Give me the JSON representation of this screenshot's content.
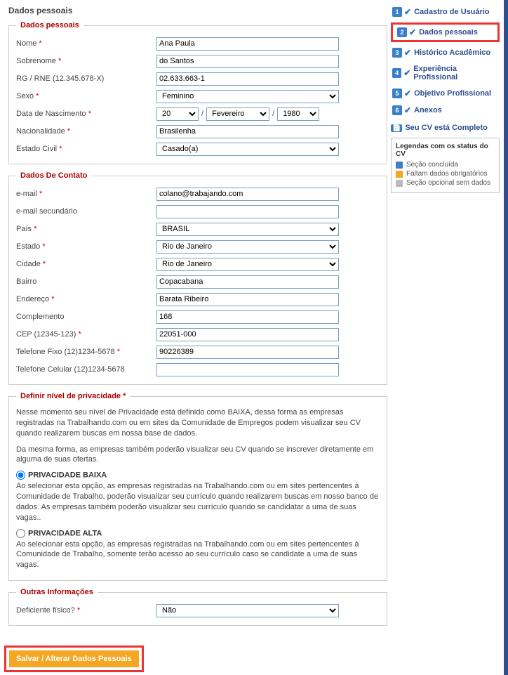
{
  "page_title": "Dados pessoais",
  "sections": {
    "personal": {
      "legend": "Dados pessoais",
      "nome_label": "Nome",
      "nome_value": "Ana Paula",
      "sobrenome_label": "Sobrenome",
      "sobrenome_value": "do Santos",
      "rg_label": "RG / RNE (12.345.678-X)",
      "rg_value": "02.633.663-1",
      "sexo_label": "Sexo",
      "sexo_value": "Feminino",
      "nasc_label": "Data de Nascimento",
      "nasc_day": "20",
      "nasc_month": "Fevereiro",
      "nasc_year": "1980",
      "nacionalidade_label": "Nacionalidade",
      "nacionalidade_value": "Brasilenha",
      "estadocivil_label": "Estado Civil",
      "estadocivil_value": "Casado(a)"
    },
    "contact": {
      "legend": "Dados De Contato",
      "email_label": "e-mail",
      "email_value": "colano@trabajando.com",
      "email2_label": "e-mail secundário",
      "email2_value": "",
      "pais_label": "País",
      "pais_value": "BRASIL",
      "estado_label": "Estado",
      "estado_value": "Rio de Janeiro",
      "cidade_label": "Cidade",
      "cidade_value": "Rio de Janeiro",
      "bairro_label": "Bairro",
      "bairro_value": "Copacabana",
      "endereco_label": "Endereço",
      "endereco_value": "Barata Ribeiro",
      "complemento_label": "Complemento",
      "complemento_value": "168",
      "cep_label": "CEP (12345-123)",
      "cep_value": "22051-000",
      "telfixo_label": "Telefone Fixo (12)1234-5678",
      "telfixo_value": "90226389",
      "telcel_label": "Telefone Celular (12)1234-5678",
      "telcel_value": ""
    },
    "privacy": {
      "legend": "Definir nível de privacidade",
      "p1": "Nesse momento seu nível de Privacidade está definido como BAIXA, dessa forma as empresas registradas na Trabalhando.com ou em sites da Comunidade de Empregos podem visualizar seu CV quando realizarem buscas em nossa base de dados.",
      "p2": "Da mesma forma, as empresas também poderão visualizar seu CV quando se inscrever diretamente em alguma de suas ofertas.",
      "low_label": "PRIVACIDADE BAIXA",
      "low_desc": "Ao selecionar esta opção, as empresas registradas na Trabalhando.com ou em sites pertencentes à Comunidade de Trabalho, poderão visualizar seu currículo quando realizarem buscas em nosso banco de dados. As empresas também poderão visualizar seu currículo quando se candidatar a uma de suas vagas..",
      "high_label": "PRIVACIDADE ALTA",
      "high_desc": "Ao selecionar esta opção, as empresas registradas na Trabalhando.com ou em sites pertencentes à Comunidade de Trabalho, somente terão acesso ao seu currículo caso se candidate a uma de suas vagas."
    },
    "other": {
      "legend": "Outras Informações",
      "deficiente_label": "Deficiente físico?",
      "deficiente_value": "Não"
    }
  },
  "save_button": "Salvar / Alterar Dados Pessoais",
  "sidebar": {
    "steps": [
      {
        "n": "1",
        "label": "Cadastro de Usuário"
      },
      {
        "n": "2",
        "label": "Dados pessoais"
      },
      {
        "n": "3",
        "label": "Histórico Acadêmico"
      },
      {
        "n": "4",
        "label": "Experiência Profissional"
      },
      {
        "n": "5",
        "label": "Objetivo Profissional"
      },
      {
        "n": "6",
        "label": "Anexos"
      }
    ],
    "cv_status": "Seu CV está Completo",
    "legend_header": "Legendas com os status do CV",
    "legend_items": [
      {
        "color": "blue",
        "label": "Seção concluída"
      },
      {
        "color": "orange",
        "label": "Faltam dados obrigatórios"
      },
      {
        "color": "gray",
        "label": "Seção opcional sem dados"
      }
    ]
  }
}
